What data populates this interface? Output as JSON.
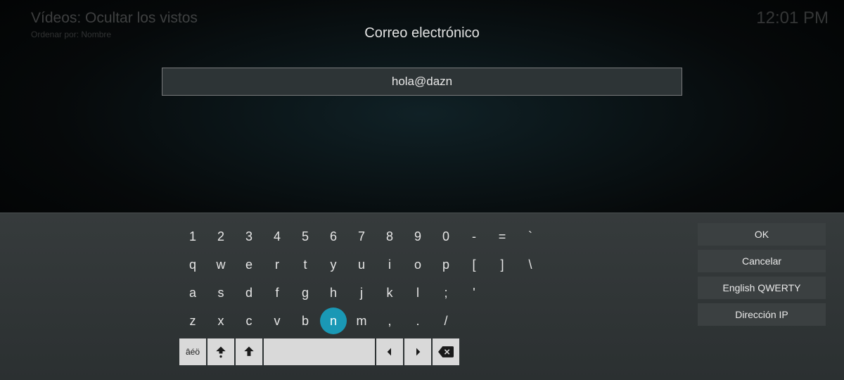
{
  "background": {
    "title": "Vídeos: Ocultar los vistos",
    "subtitle": "Ordenar por: Nombre"
  },
  "clock": "12:01 PM",
  "dialog": {
    "title": "Correo electrónico",
    "input_value": "hola@dazn"
  },
  "keyboard": {
    "row1": [
      "1",
      "2",
      "3",
      "4",
      "5",
      "6",
      "7",
      "8",
      "9",
      "0",
      "-",
      "=",
      "`"
    ],
    "row2": [
      "q",
      "w",
      "e",
      "r",
      "t",
      "y",
      "u",
      "i",
      "o",
      "p",
      "[",
      "]",
      "\\"
    ],
    "row3": [
      "a",
      "s",
      "d",
      "f",
      "g",
      "h",
      "j",
      "k",
      "l",
      ";",
      "'",
      ""
    ],
    "row4": [
      "z",
      "x",
      "c",
      "v",
      "b",
      "n",
      "m",
      ",",
      ".",
      "/"
    ],
    "highlight_key": "n",
    "accent_label": "âéö"
  },
  "side_buttons": {
    "ok": "OK",
    "cancel": "Cancelar",
    "layout": "English QWERTY",
    "ip": "Dirección IP"
  }
}
